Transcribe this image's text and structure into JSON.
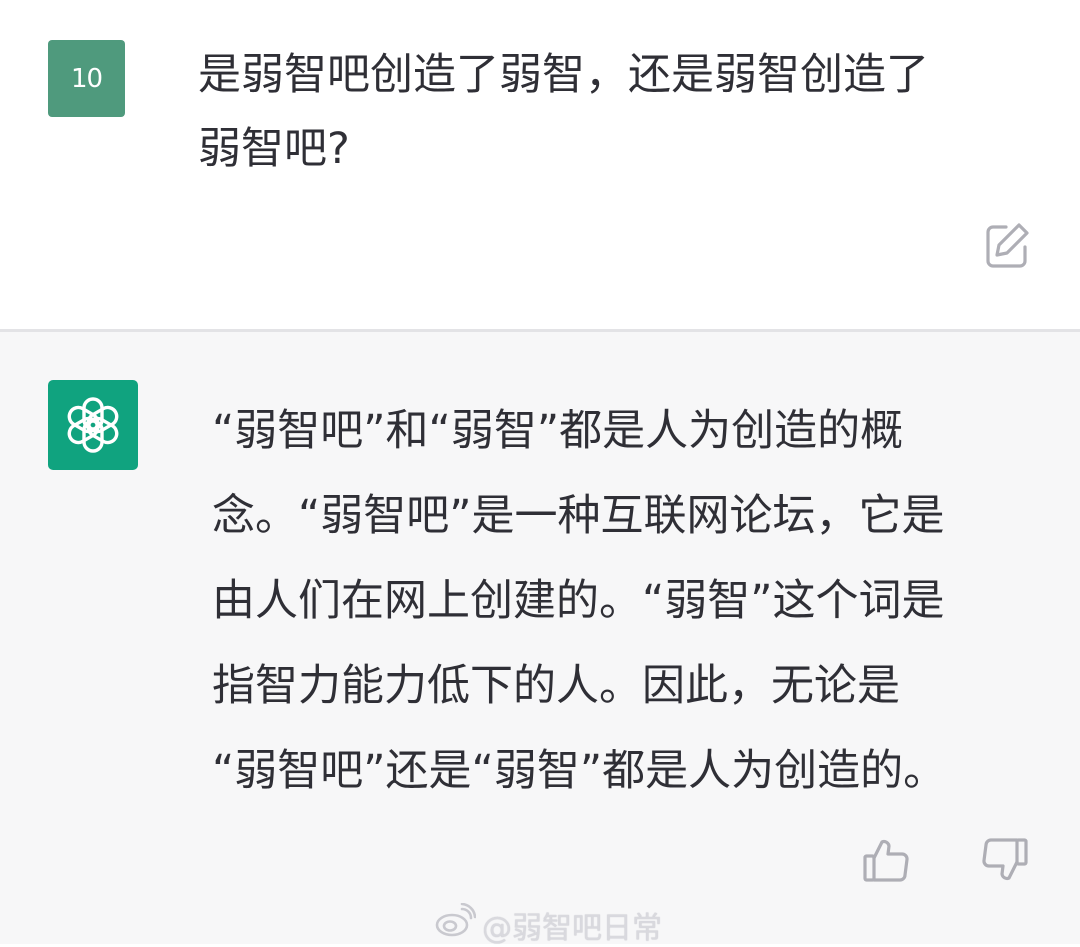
{
  "user_message": {
    "avatar_label": "10",
    "text": "是弱智吧创造了弱智，还是弱智创造了\n弱智吧?"
  },
  "assistant_message": {
    "text": "“弱智吧”和“弱智”都是人为创造的概\n念。“弱智吧”是一种互联网论坛，它是\n由人们在网上创建的。“弱智”这个词是\n指智力能力低下的人。因此，无论是\n“弱智吧”还是“弱智”都是人为创造的。"
  },
  "watermark": {
    "text": "@弱智吧日常"
  },
  "icons": {
    "user_avatar": "user-avatar",
    "assistant_avatar": "openai-logo-icon",
    "edit": "edit-icon",
    "thumbs_up": "thumbs-up-icon",
    "thumbs_down": "thumbs-down-icon",
    "watermark_logo": "weibo-logo-icon"
  },
  "colors": {
    "user_avatar_bg": "#4f9a7d",
    "assistant_avatar_bg": "#10a37f",
    "assistant_bg": "#f7f7f8",
    "text": "#2f2f36",
    "icon": "#aeaeb5"
  }
}
